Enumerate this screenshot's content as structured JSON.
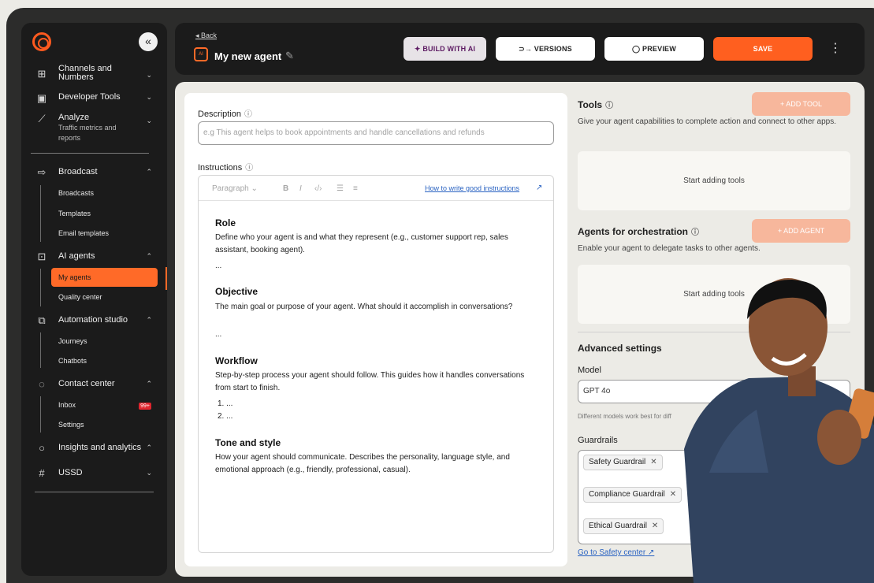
{
  "sidebar": {
    "collapse_icon": "double-chevron-left-icon",
    "items": [
      {
        "label": "Channels and Numbers",
        "icon": "grid-plus-icon"
      },
      {
        "label": "Developer Tools",
        "icon": "code-window-icon"
      },
      {
        "label": "Analyze",
        "sub": "Traffic metrics and reports",
        "icon": "line-chart-icon"
      },
      {
        "label": "Broadcast",
        "icon": "share-arrow-icon"
      },
      {
        "label": "AI agents",
        "icon": "robot-icon"
      },
      {
        "label": "Automation studio",
        "icon": "flow-icon"
      },
      {
        "label": "Contact center",
        "icon": "chat-icon"
      },
      {
        "label": "Insights and analytics",
        "icon": "bulb-icon"
      },
      {
        "label": "USSD",
        "icon": "keypad-icon"
      }
    ],
    "broadcast_children": [
      "Broadcasts",
      "Templates",
      "Email templates"
    ],
    "ai_children": [
      "My agents",
      "Quality center"
    ],
    "automation_children": [
      "Journeys",
      "Chatbots"
    ],
    "contact_children": [
      "Inbox",
      "Settings"
    ],
    "inbox_badge": "99+"
  },
  "header": {
    "back": "Back",
    "title": "My new agent",
    "build_ai": "BUILD WITH AI",
    "versions": "VERSIONS",
    "preview": "PREVIEW",
    "save": "SAVE"
  },
  "form": {
    "description_label": "Description",
    "description_placeholder": "e.g This agent helps to book appointments and handle cancellations and refunds",
    "instructions_label": "Instructions",
    "toolbar_paragraph": "Paragraph",
    "toolbar_link": "How to write good instructions",
    "sections": [
      {
        "title": "Role",
        "body": "Define who your agent is and what they represent (e.g., customer support rep, sales assistant, booking agent).",
        "extra": "..."
      },
      {
        "title": "Objective",
        "body": "The main goal or purpose of your agent. What should it accomplish in conversations?",
        "extra": "..."
      },
      {
        "title": "Workflow",
        "body": "Step-by-step process your agent should follow. This guides how it handles conversations from start to finish.",
        "list": [
          "1. ...",
          "2. ..."
        ]
      },
      {
        "title": "Tone and style",
        "body": "How your agent should communicate. Describes the personality, language style, and emotional approach (e.g., friendly, professional, casual)."
      }
    ]
  },
  "right": {
    "tools_title": "Tools",
    "add_tool": "+ ADD TOOL",
    "tools_desc": "Give your agent capabilities to complete action and connect to other apps.",
    "tools_empty": "Start adding tools",
    "orch_title": "Agents for orchestration",
    "add_agent": "+ ADD AGENT",
    "orch_desc": "Enable your agent to delegate tasks to other agents.",
    "orch_empty": "Start adding tools",
    "adv_title": "Advanced settings",
    "model_label": "Model",
    "model_value": "GPT 4o",
    "model_helper": "Different models work best for diff",
    "guardrails_label": "Guardrails",
    "guardrails": [
      "Safety Guardrail",
      "Compliance Guardrail",
      "Ethical Guardrail"
    ],
    "safety_link": "Go to Safety center"
  }
}
